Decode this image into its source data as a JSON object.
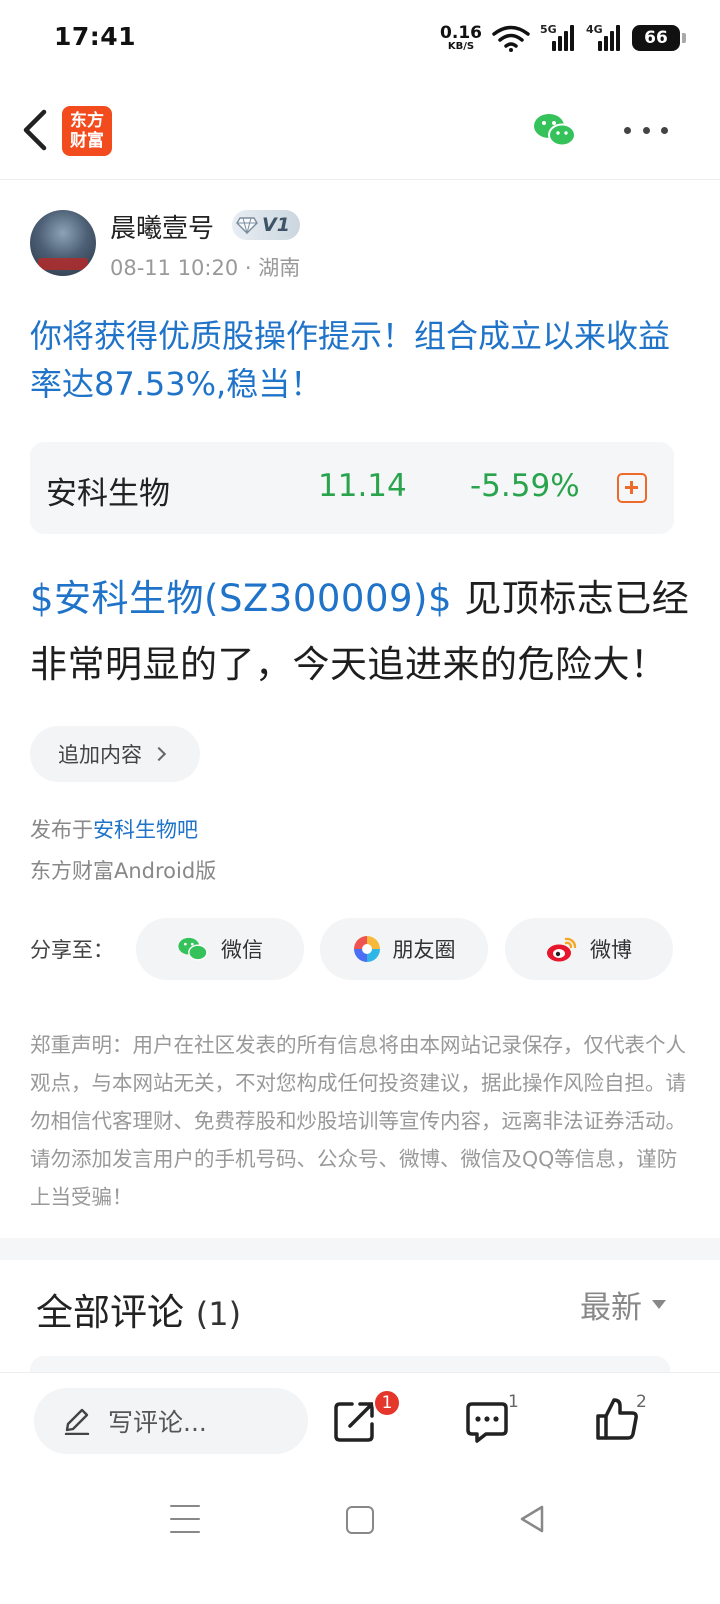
{
  "status_bar": {
    "time": "17:41",
    "net_speed": "0.16",
    "net_unit": "KB/S",
    "sig1_label": "5G",
    "sig2_label": "4G",
    "battery": "66"
  },
  "nav": {
    "logo_line1": "东方",
    "logo_line2": "财富",
    "icons": [
      "back-icon",
      "wechat-icon",
      "more-icon"
    ]
  },
  "post": {
    "author": "晨曦壹号",
    "vip_level": "V1",
    "meta": "08-11 10:20 · 湖南",
    "title": "你将获得优质股操作提示！组合成立以来收益率达87.53%,稳当！",
    "stock": {
      "name": "安科生物",
      "price": "11.14",
      "change": "-5.59%",
      "change_color": "#2aa44c"
    },
    "body_link": "$安科生物(SZ300009)$",
    "body_text": " 见顶标志已经非常明显的了，今天追进来的危险大！",
    "append_label": "追加内容",
    "published_prefix": "发布于",
    "published_bar": "安科生物吧",
    "client": "东方财富Android版"
  },
  "share": {
    "label": "分享至：",
    "wechat": "微信",
    "moments": "朋友圈",
    "weibo": "微博"
  },
  "disclaimer": "郑重声明：用户在社区发表的所有信息将由本网站记录保存，仅代表个人观点，与本网站无关，不对您构成任何投资建议，据此操作风险自担。请勿相信代客理财、免费荐股和炒股培训等宣传内容，远离非法证券活动。请勿添加发言用户的手机号码、公众号、微博、微信及QQ等信息，谨防上当受骗！",
  "comments": {
    "title": "全部评论",
    "count": "(1)",
    "sort": "最新"
  },
  "bottom_bar": {
    "write_placeholder": "写评论...",
    "forward_badge": "1",
    "comment_count": "1",
    "like_count": "2"
  },
  "colors": {
    "link_blue": "#1f73c9",
    "brand_orange": "#f24b1e",
    "stock_down_green": "#2aa44c",
    "badge_red": "#e5362b"
  }
}
